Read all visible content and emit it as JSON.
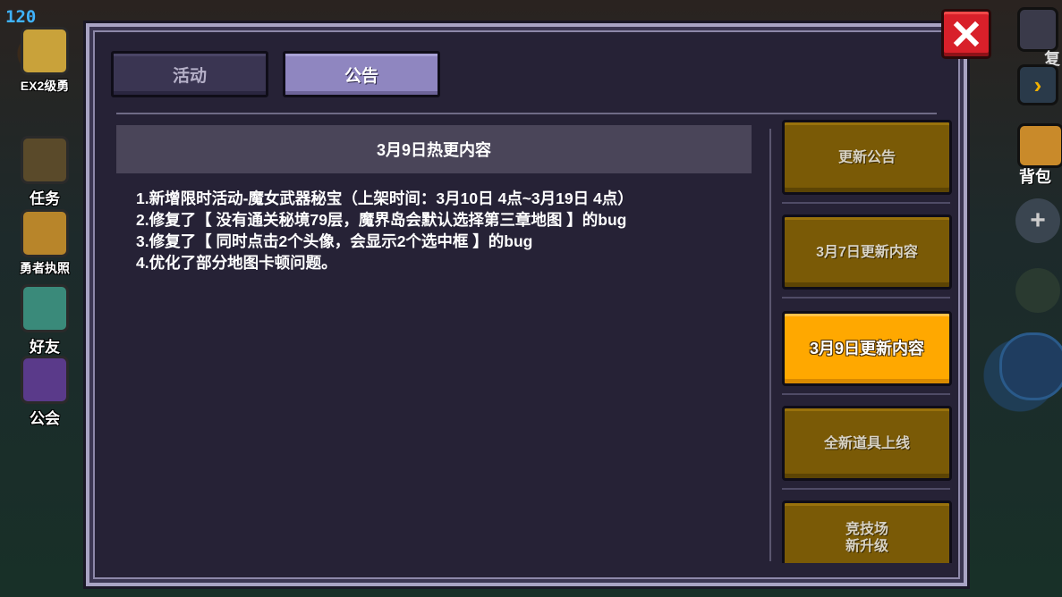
{
  "hud": {
    "fps": "120",
    "right_label_fu": "复"
  },
  "sidebar_left": [
    {
      "label": "EX2级勇",
      "icon": "hero-avatar-icon"
    },
    {
      "label": "任务",
      "icon": "quest-icon"
    },
    {
      "label": "勇者执照",
      "icon": "license-icon"
    },
    {
      "label": "好友",
      "icon": "friends-icon"
    },
    {
      "label": "公会",
      "icon": "guild-icon"
    }
  ],
  "sidebar_right": {
    "bag_label": "背包"
  },
  "tabs": [
    {
      "label": "活动",
      "active": false
    },
    {
      "label": "公告",
      "active": true
    }
  ],
  "announcement": {
    "title": "3月9日热更内容",
    "lines": [
      "1.新增限时活动-魔女武器秘宝（上架时间：3月10日 4点~3月19日 4点）",
      "2.修复了【 没有通关秘境79层，魔界岛会默认选择第三章地图 】的bug",
      "3.修复了【 同时点击2个头像，会显示2个选中框 】的bug",
      "4.优化了部分地图卡顿问题。"
    ]
  },
  "notice_list": [
    {
      "label_line1": "更新公告",
      "label_line2": "",
      "active": false
    },
    {
      "label_line1": "3月7日更新内容",
      "label_line2": "",
      "active": false
    },
    {
      "label_line1": "3月9日更新内容",
      "label_line2": "",
      "active": true
    },
    {
      "label_line1": "全新道具上线",
      "label_line2": "",
      "active": false
    },
    {
      "label_line1": "竞技场",
      "label_line2": "新升级",
      "active": false
    }
  ],
  "colors": {
    "panel_bg": "#262236",
    "tab_active": "#8f86c0",
    "item_bg": "#7a5a06",
    "item_active": "#ffa800",
    "close_red": "#d8202a"
  }
}
